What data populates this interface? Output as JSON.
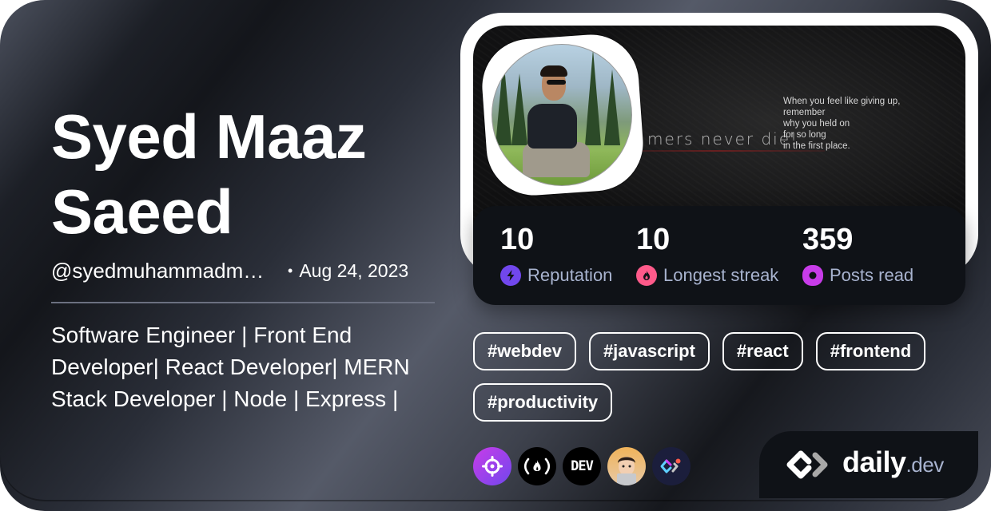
{
  "profile": {
    "name": "Syed Maaz Saeed",
    "handle": "@syedmuhammadmaaz",
    "separator": "•",
    "joined": "Aug 24, 2023",
    "bio": "Software Engineer | Front End Developer| React Developer| MERN Stack Developer | Node | Express |"
  },
  "cover": {
    "tagline": "mers never die!",
    "quote": "When you feel like giving up,\nremember\nwhy you held on\nfor so long\nin the first place."
  },
  "stats": [
    {
      "value": "10",
      "label": "Reputation",
      "icon": "lightning-icon",
      "color": "#7147ed"
    },
    {
      "value": "10",
      "label": "Longest streak",
      "icon": "flame-icon",
      "color": "#ff5a8a"
    },
    {
      "value": "359",
      "label": "Posts read",
      "icon": "eye-icon",
      "color": "#c83ce9"
    }
  ],
  "tags": [
    "#webdev",
    "#javascript",
    "#react",
    "#frontend",
    "#productivity"
  ],
  "squads": [
    {
      "name": "crosshair-squad",
      "icon": "crosshair-icon"
    },
    {
      "name": "freecodecamp",
      "icon": "fire-parens-icon",
      "text": "(🔥)"
    },
    {
      "name": "dev-to",
      "icon": "dev-logo",
      "text": "DEV"
    },
    {
      "name": "devsquad",
      "icon": "memoji-avatar"
    },
    {
      "name": "daily-dev-squad",
      "icon": "daily-dev-color-icon"
    }
  ],
  "brand": {
    "word": "daily",
    "tld": ".dev"
  },
  "colors": {
    "reputation": "#7147ed",
    "streak": "#ff5a8a",
    "posts": "#c83ce9",
    "label": "#a8b3cf",
    "panel": "#0f1217"
  }
}
